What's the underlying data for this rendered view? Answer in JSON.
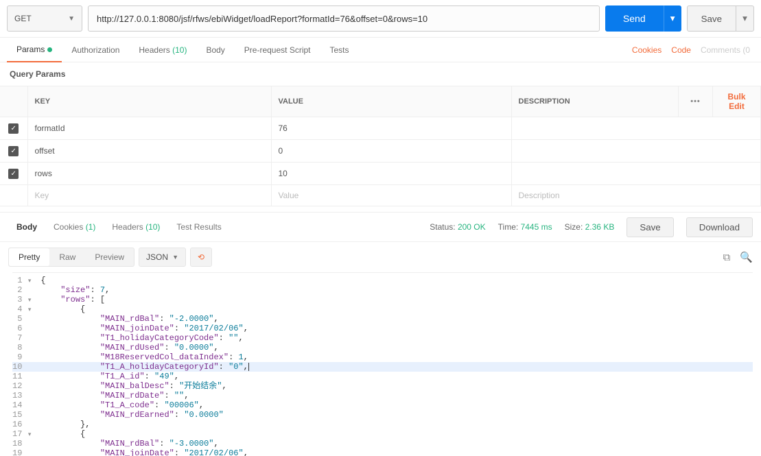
{
  "method": "GET",
  "url": "http://127.0.0.1:8080/jsf/rfws/ebiWidget/loadReport?formatId=76&offset=0&rows=10",
  "buttons": {
    "send": "Send",
    "save": "Save"
  },
  "tabs": {
    "params": "Params",
    "authorization": "Authorization",
    "headers": "Headers",
    "headers_count": "(10)",
    "body": "Body",
    "prerequest": "Pre-request Script",
    "tests": "Tests"
  },
  "links": {
    "cookies": "Cookies",
    "code": "Code",
    "comments": "Comments (0"
  },
  "section_title": "Query Params",
  "table": {
    "head_key": "KEY",
    "head_value": "VALUE",
    "head_desc": "DESCRIPTION",
    "bulk": "Bulk Edit",
    "ph_key": "Key",
    "ph_value": "Value",
    "ph_desc": "Description",
    "rows": [
      {
        "key": "formatId",
        "value": "76",
        "desc": ""
      },
      {
        "key": "offset",
        "value": "0",
        "desc": ""
      },
      {
        "key": "rows",
        "value": "10",
        "desc": ""
      }
    ]
  },
  "resp_tabs": {
    "body": "Body",
    "cookies": "Cookies",
    "cookies_count": "(1)",
    "headers": "Headers",
    "headers_count": "(10)",
    "tests": "Test Results"
  },
  "resp_meta": {
    "status_label": "Status:",
    "status_value": "200 OK",
    "time_label": "Time:",
    "time_value": "7445 ms",
    "size_label": "Size:",
    "size_value": "2.36 KB"
  },
  "resp_buttons": {
    "save": "Save",
    "download": "Download"
  },
  "viewer": {
    "pretty": "Pretty",
    "raw": "Raw",
    "preview": "Preview",
    "format": "JSON"
  },
  "highlighted_line": 10,
  "code_lines": [
    {
      "n": 1,
      "fold": true,
      "indent": 0,
      "txt": [
        [
          "pun",
          "{"
        ]
      ]
    },
    {
      "n": 2,
      "indent": 1,
      "txt": [
        [
          "key",
          "\"size\""
        ],
        [
          "pun",
          ": "
        ],
        [
          "num",
          "7"
        ],
        [
          "pun",
          ","
        ]
      ]
    },
    {
      "n": 3,
      "fold": true,
      "indent": 1,
      "txt": [
        [
          "key",
          "\"rows\""
        ],
        [
          "pun",
          ": ["
        ]
      ]
    },
    {
      "n": 4,
      "fold": true,
      "indent": 2,
      "txt": [
        [
          "pun",
          "{"
        ]
      ]
    },
    {
      "n": 5,
      "indent": 3,
      "txt": [
        [
          "key",
          "\"MAIN_rdBal\""
        ],
        [
          "pun",
          ": "
        ],
        [
          "str",
          "\"-2.0000\""
        ],
        [
          "pun",
          ","
        ]
      ]
    },
    {
      "n": 6,
      "indent": 3,
      "txt": [
        [
          "key",
          "\"MAIN_joinDate\""
        ],
        [
          "pun",
          ": "
        ],
        [
          "str",
          "\"2017/02/06\""
        ],
        [
          "pun",
          ","
        ]
      ]
    },
    {
      "n": 7,
      "indent": 3,
      "txt": [
        [
          "key",
          "\"T1_holidayCategoryCode\""
        ],
        [
          "pun",
          ": "
        ],
        [
          "str",
          "\"\""
        ],
        [
          "pun",
          ","
        ]
      ]
    },
    {
      "n": 8,
      "indent": 3,
      "txt": [
        [
          "key",
          "\"MAIN_rdUsed\""
        ],
        [
          "pun",
          ": "
        ],
        [
          "str",
          "\"0.0000\""
        ],
        [
          "pun",
          ","
        ]
      ]
    },
    {
      "n": 9,
      "indent": 3,
      "txt": [
        [
          "key",
          "\"M18ReservedCol_dataIndex\""
        ],
        [
          "pun",
          ": "
        ],
        [
          "num",
          "1"
        ],
        [
          "pun",
          ","
        ]
      ]
    },
    {
      "n": 10,
      "indent": 3,
      "txt": [
        [
          "key",
          "\"T1_A_holidayCategoryId\""
        ],
        [
          "pun",
          ": "
        ],
        [
          "str",
          "\"0\""
        ],
        [
          "pun",
          ","
        ]
      ],
      "caret": true
    },
    {
      "n": 11,
      "indent": 3,
      "txt": [
        [
          "key",
          "\"T1_A_id\""
        ],
        [
          "pun",
          ": "
        ],
        [
          "str",
          "\"49\""
        ],
        [
          "pun",
          ","
        ]
      ]
    },
    {
      "n": 12,
      "indent": 3,
      "txt": [
        [
          "key",
          "\"MAIN_balDesc\""
        ],
        [
          "pun",
          ": "
        ],
        [
          "str",
          "\"开始结余\""
        ],
        [
          "pun",
          ","
        ]
      ]
    },
    {
      "n": 13,
      "indent": 3,
      "txt": [
        [
          "key",
          "\"MAIN_rdDate\""
        ],
        [
          "pun",
          ": "
        ],
        [
          "str",
          "\"\""
        ],
        [
          "pun",
          ","
        ]
      ]
    },
    {
      "n": 14,
      "indent": 3,
      "txt": [
        [
          "key",
          "\"T1_A_code\""
        ],
        [
          "pun",
          ": "
        ],
        [
          "str",
          "\"00006\""
        ],
        [
          "pun",
          ","
        ]
      ]
    },
    {
      "n": 15,
      "indent": 3,
      "txt": [
        [
          "key",
          "\"MAIN_rdEarned\""
        ],
        [
          "pun",
          ": "
        ],
        [
          "str",
          "\"0.0000\""
        ]
      ]
    },
    {
      "n": 16,
      "indent": 2,
      "txt": [
        [
          "pun",
          "},"
        ]
      ]
    },
    {
      "n": 17,
      "fold": true,
      "indent": 2,
      "txt": [
        [
          "pun",
          "{"
        ]
      ]
    },
    {
      "n": 18,
      "indent": 3,
      "txt": [
        [
          "key",
          "\"MAIN_rdBal\""
        ],
        [
          "pun",
          ": "
        ],
        [
          "str",
          "\"-3.0000\""
        ],
        [
          "pun",
          ","
        ]
      ]
    },
    {
      "n": 19,
      "indent": 3,
      "txt": [
        [
          "key",
          "\"MAIN_joinDate\""
        ],
        [
          "pun",
          ": "
        ],
        [
          "str",
          "\"2017/02/06\""
        ],
        [
          "pun",
          ","
        ]
      ]
    }
  ]
}
